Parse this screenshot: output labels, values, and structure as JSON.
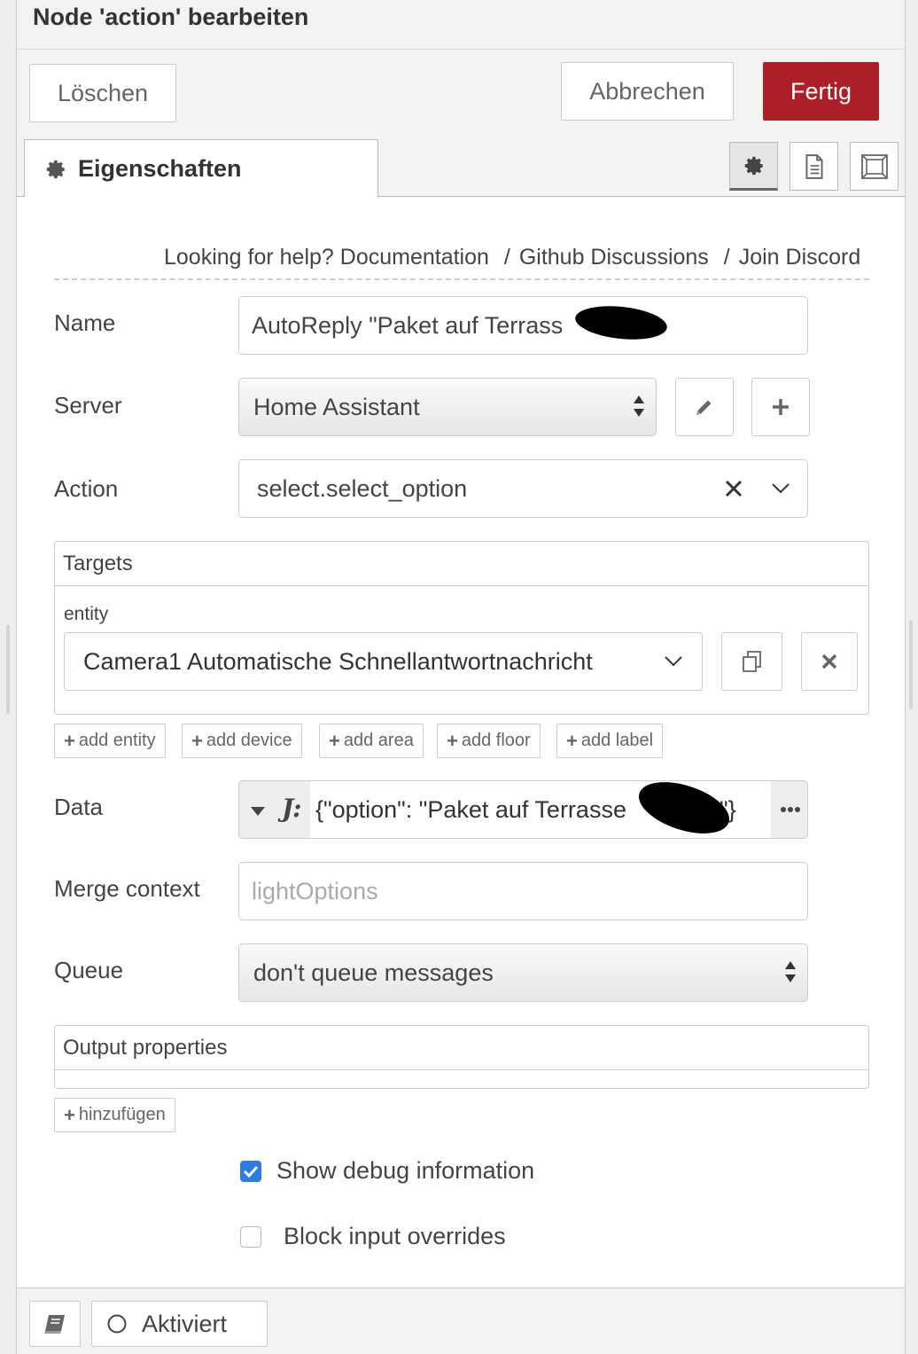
{
  "header": {
    "title": "Node 'action' bearbeiten"
  },
  "toolbar": {
    "delete_label": "Löschen",
    "cancel_label": "Abbrechen",
    "done_label": "Fertig"
  },
  "tabs": {
    "properties_label": "Eigenschaften"
  },
  "help": {
    "prefix": "Looking for help?",
    "documentation": "Documentation",
    "separator": "/",
    "github": "Github Discussions",
    "discord": "Join Discord"
  },
  "fields": {
    "name": {
      "label": "Name",
      "value": "AutoReply \"Paket auf Terrass"
    },
    "server": {
      "label": "Server",
      "value": "Home Assistant"
    },
    "action": {
      "label": "Action",
      "value": "select.select_option"
    },
    "targets": {
      "header": "Targets",
      "entity_label": "entity",
      "entity_value": "Camera1 Automatische Schnellantwortnachricht",
      "add_entity": "add entity",
      "add_device": "add device",
      "add_area": "add area",
      "add_floor": "add floor",
      "add_label": "add label"
    },
    "data": {
      "label": "Data",
      "value": "{\"option\": \"Paket auf Terrasse",
      "closing": "\"}"
    },
    "merge_context": {
      "label": "Merge context",
      "placeholder": "lightOptions"
    },
    "queue": {
      "label": "Queue",
      "value": "don't queue messages"
    },
    "output": {
      "header": "Output properties",
      "add_label": "hinzufügen"
    },
    "debug": {
      "label": "Show debug information",
      "checked": true
    },
    "block_input": {
      "label": "Block input overrides",
      "checked": false
    }
  },
  "footer": {
    "status_label": "Aktiviert"
  },
  "colors": {
    "primary": "#ad1f26",
    "checkbox": "#2d7be5"
  }
}
